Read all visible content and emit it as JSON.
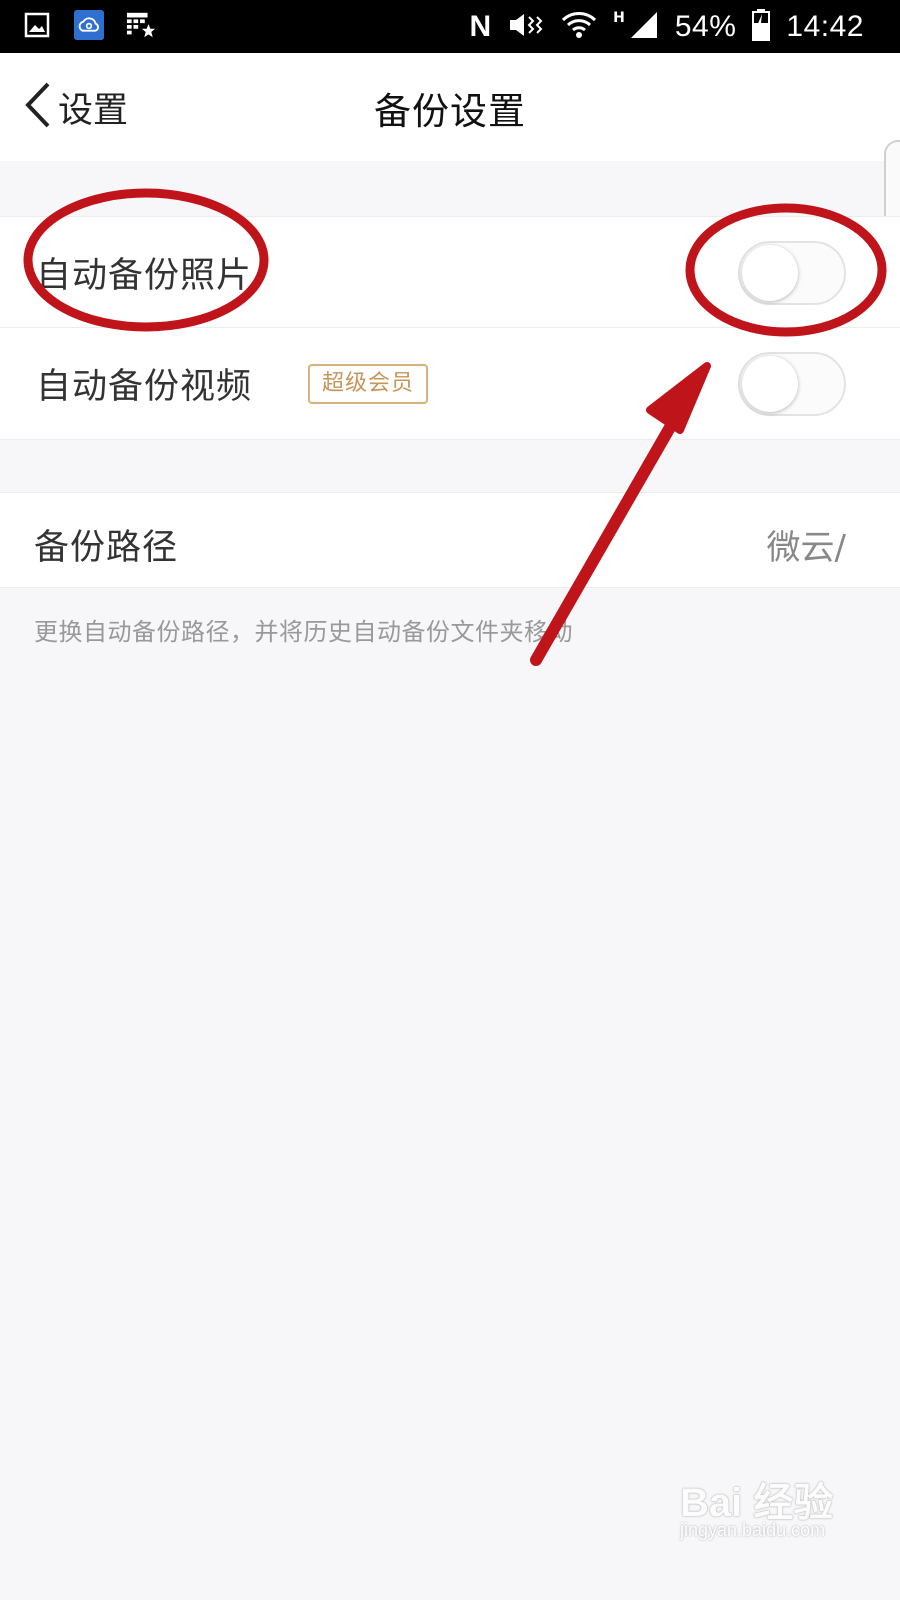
{
  "status_bar": {
    "battery": "54%",
    "time": "14:42",
    "network_letter": "H",
    "nfc_letter": "N",
    "left_icons": [
      "gallery-icon",
      "weiyun-cloud-icon",
      "calendar-star-icon"
    ],
    "right_icons": [
      "nfc-icon",
      "vibrate-icon",
      "wifi-icon",
      "signal-icon",
      "battery-icon"
    ]
  },
  "nav": {
    "back_label": "设置",
    "title": "备份设置"
  },
  "settings": {
    "auto_photo": {
      "label": "自动备份照片",
      "enabled": false
    },
    "auto_video": {
      "label": "自动备份视频",
      "badge": "超级会员",
      "enabled": false
    },
    "backup_path": {
      "label": "备份路径",
      "value": "微云/"
    },
    "hint": "更换自动备份路径，并将历史自动备份文件夹移动"
  },
  "annotation": {
    "color": "#c0141b"
  },
  "watermark": {
    "brand": "Bai 经验",
    "url": "jingyan.baidu.com"
  },
  "colors": {
    "page_bg": "#f7f6f9",
    "badge_border": "#d9b27a",
    "badge_text": "#c8955a"
  }
}
